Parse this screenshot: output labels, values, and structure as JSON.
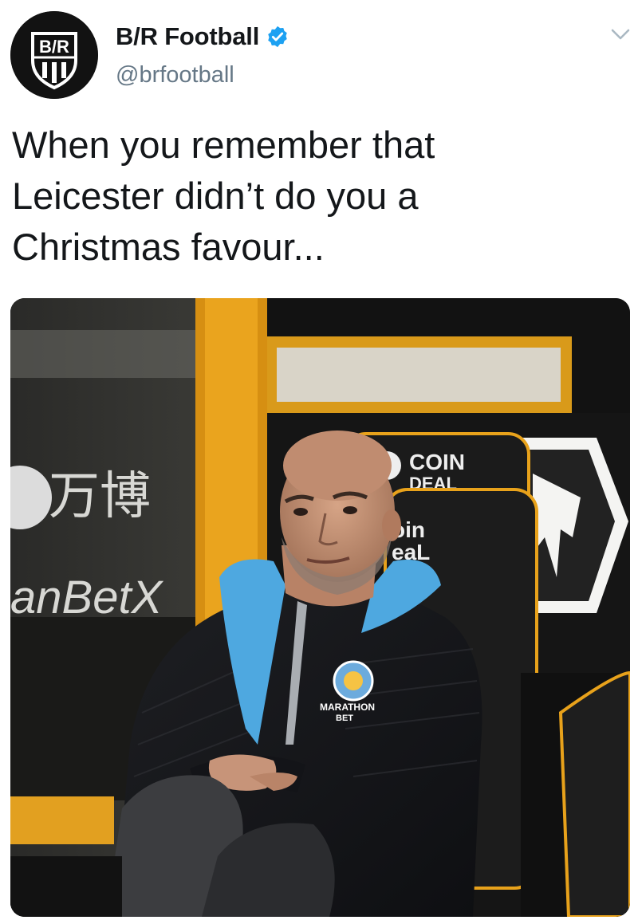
{
  "account": {
    "display_name": "B/R Football",
    "handle": "@brfootball",
    "avatar_text": "B/R",
    "verified": true,
    "verified_icon": "verified-badge-icon"
  },
  "menu_icon": "chevron-down-icon",
  "tweet": {
    "text_lines": [
      "When you remember that",
      "Leicester didn’t do you a",
      "Christmas favour..."
    ]
  },
  "media": {
    "signage": {
      "sponsor_cn": "万博",
      "sponsor_en": "anBetX",
      "seat_brand_1": "COIN",
      "seat_brand_1b": "DEAL",
      "seat_brand_2": "oin",
      "seat_brand_2b": "eaL",
      "jacket_sponsor": "MARATHON",
      "jacket_sponsor_2": "BET"
    }
  },
  "colors": {
    "text": "#14171a",
    "secondary": "#657786",
    "verified": "#1da1f2",
    "wolves_orange": "#e8a21b",
    "jacket_blue": "#4ea8e0"
  }
}
